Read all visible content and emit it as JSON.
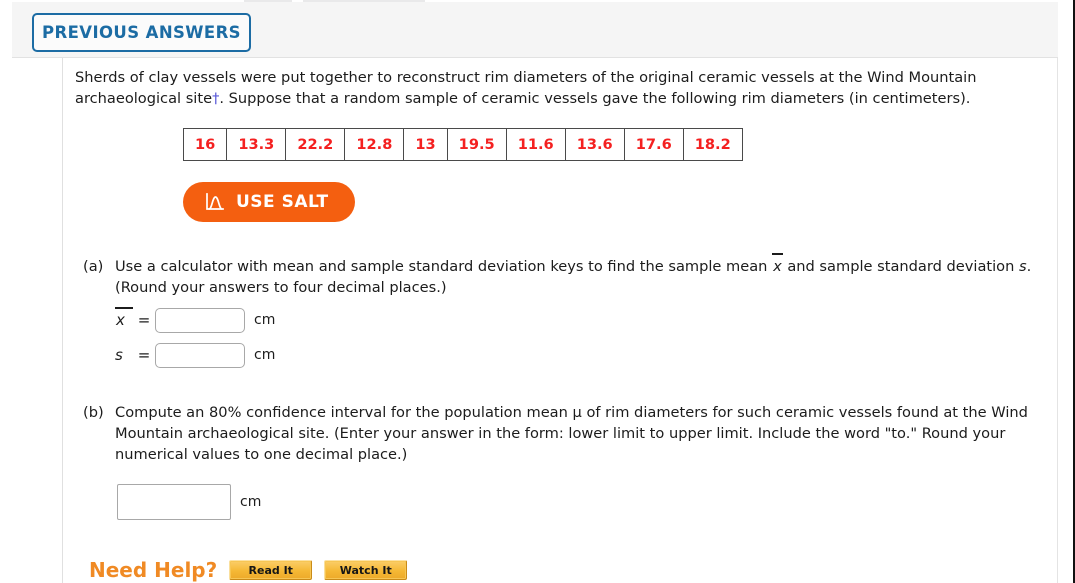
{
  "header": {
    "previous_answers_label": "PREVIOUS ANSWERS"
  },
  "problem": {
    "intro_part1": "Sherds of clay vessels were put together to reconstruct rim diameters of the original ceramic vessels at the Wind Mountain archaeological site",
    "dagger": "†",
    "intro_part2": ". Suppose that a random sample of ceramic vessels gave the following rim diameters (in centimeters)."
  },
  "data_table": {
    "values": [
      "16",
      "13.3",
      "22.2",
      "12.8",
      "13",
      "19.5",
      "11.6",
      "13.6",
      "17.6",
      "18.2"
    ]
  },
  "salt": {
    "label": "USE SALT",
    "icon": "distribution-curve-icon"
  },
  "parts": {
    "a": {
      "label": "(a)",
      "text_before_xbar": "Use a calculator with mean and sample standard deviation keys to find the sample mean ",
      "xbar_symbol": "x",
      "text_middle": " and sample standard deviation ",
      "s_symbol": "s",
      "text_after": ".",
      "rounding_note": "(Round your answers to four decimal places.)",
      "rows": [
        {
          "symbol": "x",
          "overbar": true,
          "equals": "=",
          "value": "",
          "unit": "cm"
        },
        {
          "symbol": "s",
          "overbar": false,
          "equals": "=",
          "value": "",
          "unit": "cm"
        }
      ]
    },
    "b": {
      "label": "(b)",
      "text": "Compute an 80% confidence interval for the population mean μ of rim diameters for such ceramic vessels found at the Wind Mountain archaeological site. (Enter your answer in the form: lower limit to upper limit. Include the word \"to.\" Round your numerical values to one decimal place.)",
      "value": "",
      "unit": "cm"
    }
  },
  "need_help": {
    "label": "Need Help?",
    "read_it_label": "Read It",
    "watch_it_label": "Watch It"
  },
  "colors": {
    "accent_blue": "#1c6ca4",
    "data_red": "#f42020",
    "salt_orange": "#f45f10",
    "help_orange": "#f08a24",
    "help_button_gold": "#f5b835"
  }
}
